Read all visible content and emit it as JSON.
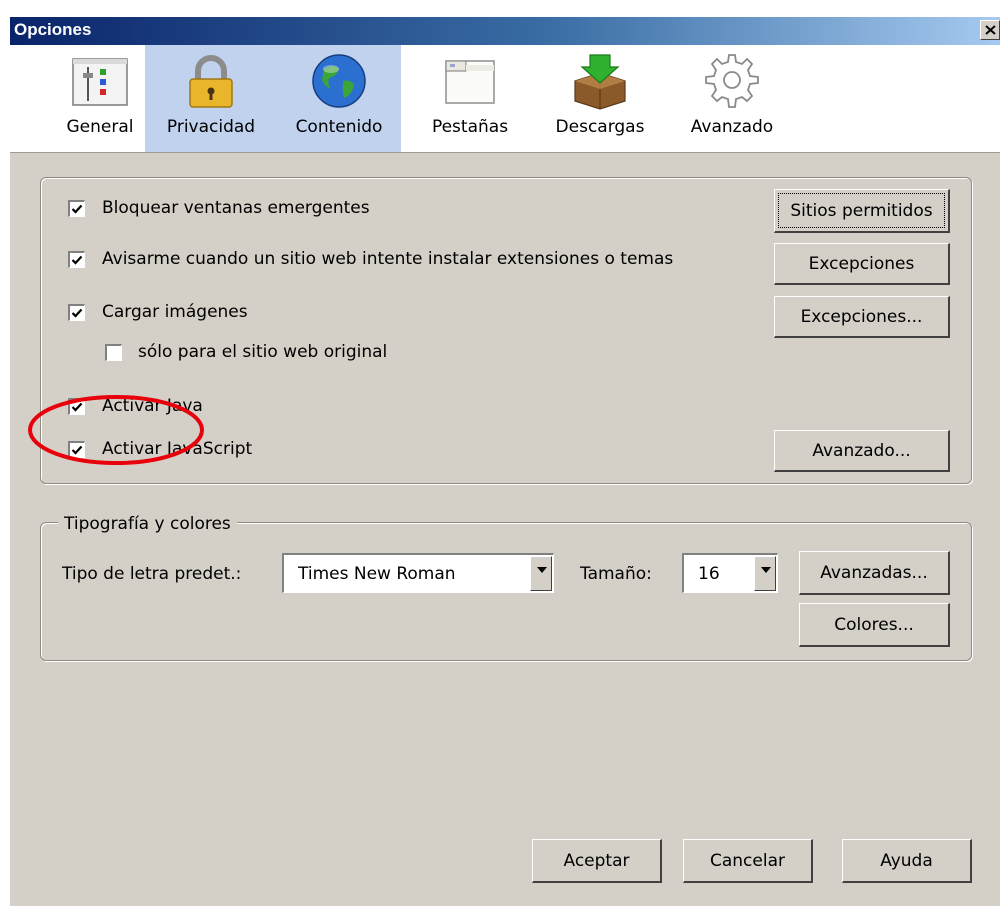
{
  "window": {
    "title": "Opciones"
  },
  "tabs": [
    {
      "label": "General",
      "icon": "general-icon",
      "selected": false
    },
    {
      "label": "Privacidad",
      "icon": "lock-icon",
      "selected": true
    },
    {
      "label": "Contenido",
      "icon": "globe-icon",
      "selected": true
    },
    {
      "label": "Pestañas",
      "icon": "tabs-window-icon",
      "selected": false
    },
    {
      "label": "Descargas",
      "icon": "download-box-icon",
      "selected": false
    },
    {
      "label": "Avanzado",
      "icon": "gear-icon",
      "selected": false
    }
  ],
  "content": {
    "popups_label": "Bloquear ventanas emergentes",
    "popups_checked": true,
    "allowed_sites_button": "Sitios permitidos",
    "warn_label": "Avisarme cuando un sitio web intente instalar extensiones o temas",
    "warn_checked": true,
    "exceptions_button": "Excepciones",
    "images_label": "Cargar imágenes",
    "images_checked": true,
    "exceptions2_button": "Excepciones...",
    "original_only_label": "sólo para el sitio web original",
    "original_only_checked": false,
    "java_label": "Activar Java",
    "java_checked": true,
    "javascript_label": "Activar JavaScript",
    "javascript_checked": true,
    "advanced_button": "Avanzado..."
  },
  "fonts": {
    "group_label": "Tipografía y colores",
    "default_font_label": "Tipo de letra predet.:",
    "default_font_value": "Times New Roman",
    "size_label": "Tamaño:",
    "size_value": "16",
    "advanced_button": "Avanzadas...",
    "colors_button": "Colores..."
  },
  "footer": {
    "ok_button": "Aceptar",
    "cancel_button": "Cancelar",
    "help_button": "Ayuda"
  },
  "colors": {
    "title_gradient_start": "#0a246a",
    "dialog_bg": "#d4d0c8",
    "selected_tab": "#c1d2ee",
    "annotation_red": "#e8000b"
  }
}
